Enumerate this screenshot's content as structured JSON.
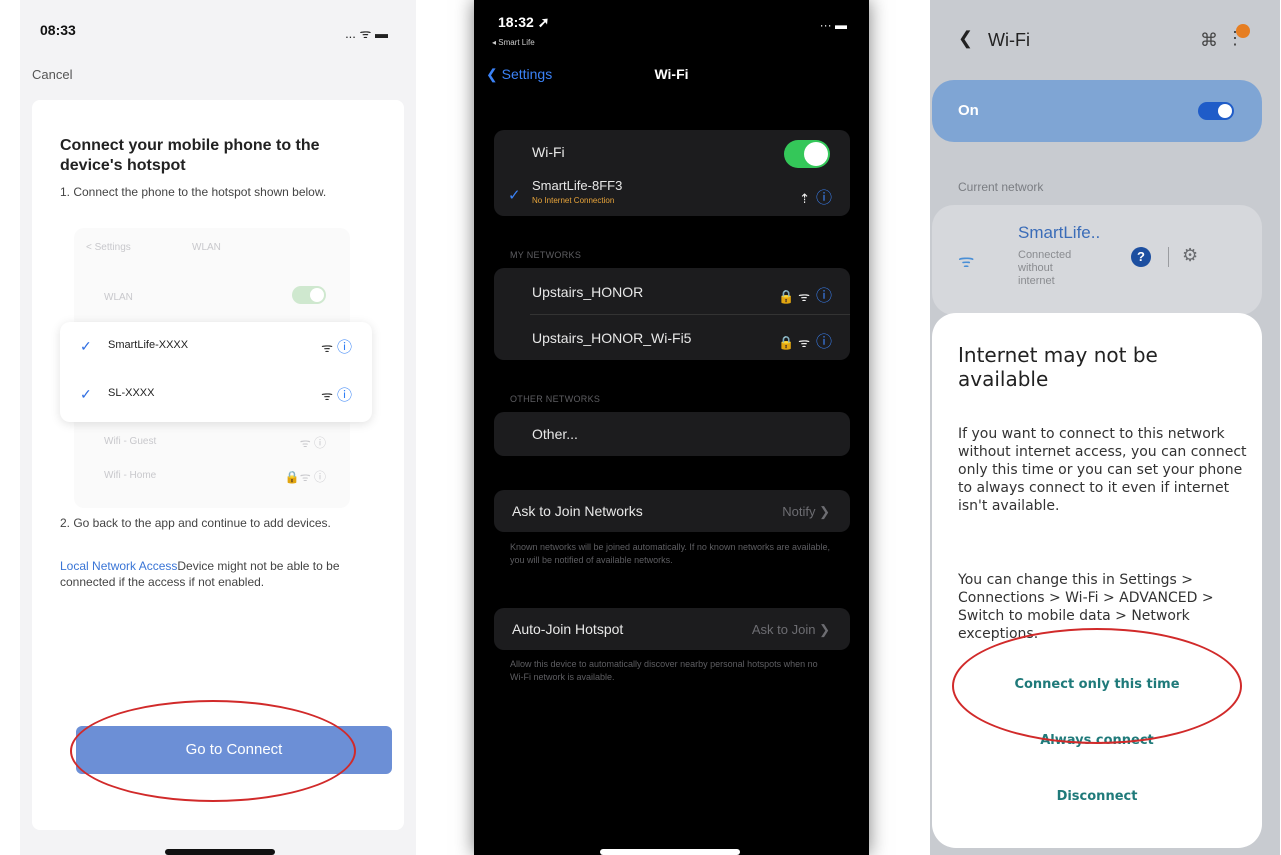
{
  "phone1": {
    "status_time": "08:33",
    "status_right": "... ᯤ ▬",
    "cancel": "Cancel",
    "title": "Connect your mobile phone to the device's hotspot",
    "step1": "1. Connect the phone to the hotspot shown below.",
    "mock": {
      "back": "< Settings",
      "title": "WLAN",
      "wlan_label": "WLAN",
      "networks": [
        "SmartLife-XXXX",
        "SL-XXXX"
      ],
      "faded_networks": [
        "Wifi - Guest",
        "Wifi - Home"
      ]
    },
    "step2": "2. Go back to the app and continue to add devices.",
    "link": "Local Network Access",
    "note": "Device might not be able to be connected if the access if not enabled.",
    "button": "Go to Connect"
  },
  "phone2": {
    "status_time": "18:32",
    "back_app": "◂ Smart Life",
    "nav_back": "Settings",
    "nav_title": "Wi-Fi",
    "wifi_label": "Wi-Fi",
    "current_network": "SmartLife-8FF3",
    "current_sub": "No Internet Connection",
    "my_networks_label": "MY NETWORKS",
    "my_networks": [
      "Upstairs_HONOR",
      "Upstairs_HONOR_Wi-Fi5"
    ],
    "other_networks_label": "OTHER NETWORKS",
    "other": "Other...",
    "ask_join": "Ask to Join Networks",
    "ask_join_value": "Notify",
    "ask_join_foot": "Known networks will be joined automatically. If no known networks are available, you will be notified of available networks.",
    "auto_join": "Auto-Join Hotspot",
    "auto_join_value": "Ask to Join",
    "auto_join_foot": "Allow this device to automatically discover nearby personal hotspots when no Wi-Fi network is available."
  },
  "phone3": {
    "title": "Wi-Fi",
    "on_label": "On",
    "current_label": "Current network",
    "network_name": "SmartLife..",
    "network_sub": "Connected without internet",
    "dialog_title": "Internet may not be available",
    "dialog_p1": "If you want to connect to this network without internet access, you can connect only this time or you can set your phone to always connect to it even if internet isn't available.",
    "dialog_p2": "You can change this in Settings > Connections > Wi-Fi > ADVANCED > Switch to mobile data > Network exceptions.",
    "action_once": "Connect only this time",
    "action_always": "Always connect",
    "action_disconnect": "Disconnect"
  },
  "colors": {
    "ios_blue": "#3b82f6",
    "ios_green": "#34c759",
    "app_button": "#6c8fd6",
    "annotation_red": "#d12a2a",
    "samsung_action": "#1f7a7a"
  }
}
